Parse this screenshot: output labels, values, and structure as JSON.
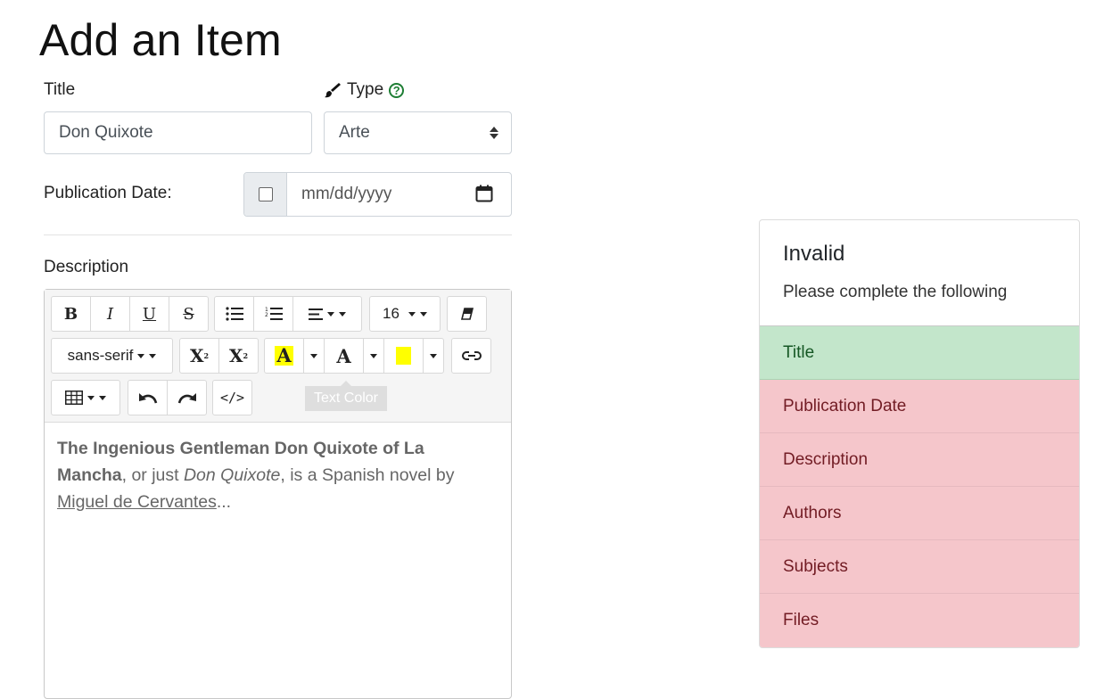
{
  "page": {
    "title": "Add an Item"
  },
  "form": {
    "title_label": "Title",
    "title_value": "Don Quixote",
    "type_label": "Type",
    "type_help": "?",
    "type_value": "Arte",
    "pubdate_label": "Publication Date:",
    "pubdate_placeholder": "mm/dd/yyyy",
    "description_label": "Description"
  },
  "toolbar": {
    "bold": "B",
    "italic": "I",
    "underline": "U",
    "strike": "S",
    "font_size": "16",
    "font_family": "sans-serif",
    "superscript": "X",
    "subscript": "X",
    "highlight_letter": "A",
    "text_color_letter": "A",
    "code_view": "</>",
    "tooltip": "Text Color",
    "highlight_color": "#ffff00"
  },
  "editor": {
    "bold_title": "The Ingenious Gentleman Don Quixote of La Mancha",
    "text1": ", or just ",
    "italic": "Don Quixote",
    "text2": ", is a Spanish novel by ",
    "link": "Miguel de Cervantes",
    "ellipsis": "..."
  },
  "validation": {
    "title": "Invalid",
    "subtitle": "Please complete the following",
    "items": [
      {
        "label": "Title",
        "status": "ok"
      },
      {
        "label": "Publication Date",
        "status": "bad"
      },
      {
        "label": "Description",
        "status": "bad"
      },
      {
        "label": "Authors",
        "status": "bad"
      },
      {
        "label": "Subjects",
        "status": "bad"
      },
      {
        "label": "Files",
        "status": "bad"
      }
    ]
  }
}
